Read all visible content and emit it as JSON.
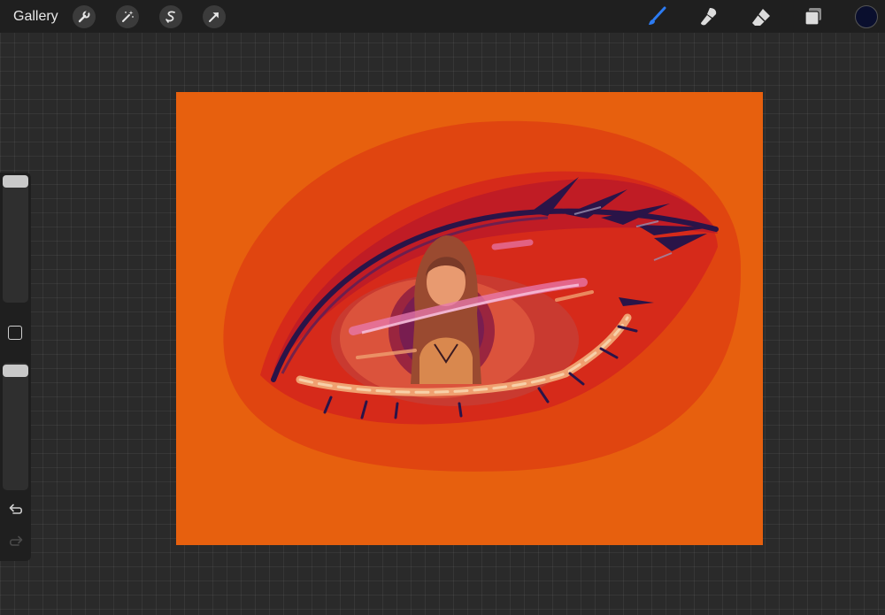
{
  "topbar": {
    "gallery_label": "Gallery",
    "left_tools": [
      "wrench-icon",
      "magic-wand-icon",
      "selection-icon",
      "transform-arrow-icon"
    ],
    "right_tools": [
      "brush-icon",
      "smudge-icon",
      "eraser-icon",
      "layers-icon"
    ],
    "active_tool": "brush-icon",
    "current_color": "#0a0f2e"
  },
  "sidebar": {
    "brush_size_level": 1.0,
    "opacity_level": 1.0,
    "controls": [
      "brush-size-slider",
      "modify-button",
      "opacity-slider",
      "undo-icon",
      "redo-icon"
    ]
  },
  "canvas": {
    "background_color": "#e7600e",
    "accent_colors": [
      "#e04510",
      "#d62a1a",
      "#8a1a40",
      "#2a1448",
      "#f0a070",
      "#e87ab0"
    ]
  }
}
